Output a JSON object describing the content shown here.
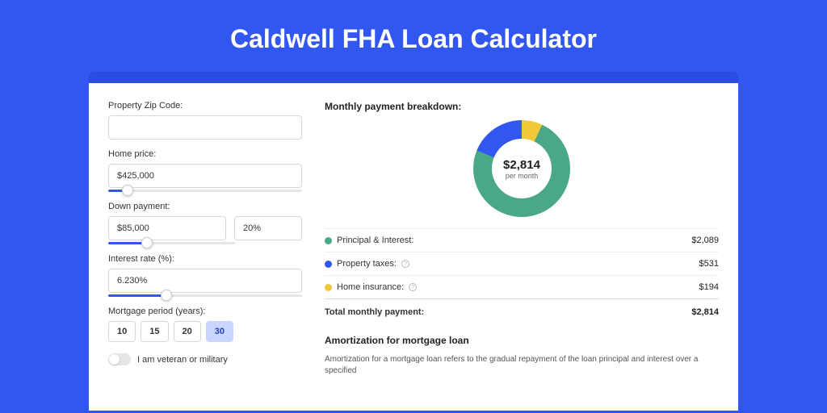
{
  "title": "Caldwell FHA Loan Calculator",
  "form": {
    "zip": {
      "label": "Property Zip Code:",
      "value": ""
    },
    "home_price": {
      "label": "Home price:",
      "value": "$425,000",
      "slider_pct": 10
    },
    "down_payment": {
      "label": "Down payment:",
      "amount": "$85,000",
      "pct": "20%",
      "slider_pct": 20
    },
    "interest": {
      "label": "Interest rate (%):",
      "value": "6.230%",
      "slider_pct": 30
    },
    "period": {
      "label": "Mortgage period (years):",
      "options": [
        "10",
        "15",
        "20",
        "30"
      ],
      "active": "30"
    },
    "veteran": {
      "label": "I am veteran or military",
      "on": false
    }
  },
  "breakdown": {
    "title": "Monthly payment breakdown:",
    "donut": {
      "value": "$2,814",
      "label": "per month"
    },
    "rows": [
      {
        "swatch": "s-green",
        "label": "Principal & Interest:",
        "value": "$2,089",
        "info": false
      },
      {
        "swatch": "s-blue",
        "label": "Property taxes:",
        "value": "$531",
        "info": true
      },
      {
        "swatch": "s-yellow",
        "label": "Home insurance:",
        "value": "$194",
        "info": true
      }
    ],
    "total": {
      "label": "Total monthly payment:",
      "value": "$2,814"
    }
  },
  "amort": {
    "title": "Amortization for mortgage loan",
    "text": "Amortization for a mortgage loan refers to the gradual repayment of the loan principal and interest over a specified"
  },
  "chart_data": {
    "type": "pie",
    "title": "Monthly payment breakdown",
    "series": [
      {
        "name": "Principal & Interest",
        "value": 2089,
        "color": "#4aa886"
      },
      {
        "name": "Property taxes",
        "value": 531,
        "color": "#3257f0"
      },
      {
        "name": "Home insurance",
        "value": 194,
        "color": "#f0c93a"
      }
    ],
    "total": 2814,
    "center_label": "$2,814 per month"
  }
}
